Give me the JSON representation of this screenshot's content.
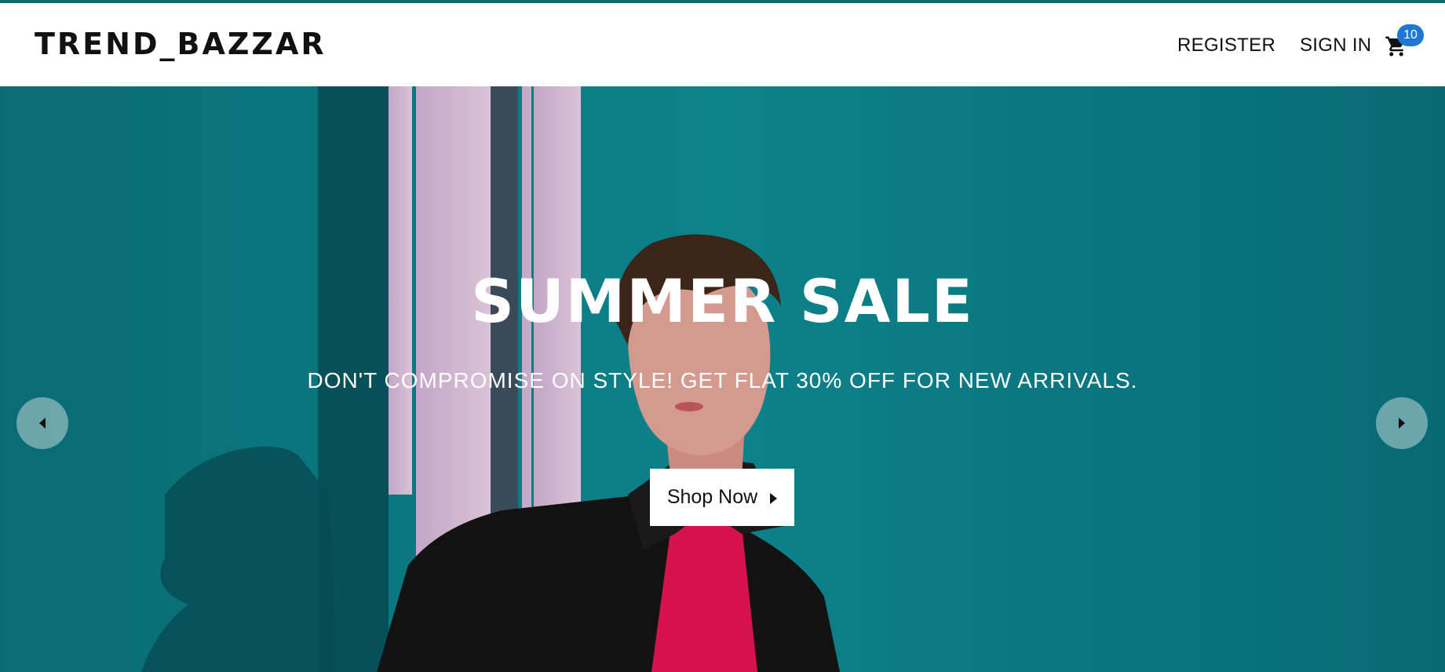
{
  "brand": {
    "logo_text": "TREND_BAZZAR"
  },
  "nav": {
    "register_label": "REGISTER",
    "signin_label": "SIGN IN",
    "cart_icon": "shopping-cart-icon",
    "cart_count": "10"
  },
  "hero": {
    "title": "SUMMER SALE",
    "subtitle": "DON'T COMPROMISE ON STYLE! GET FLAT 30% OFF FOR NEW ARRIVALS.",
    "cta_label": "Shop Now",
    "cta_icon": "caret-right-icon",
    "prev_icon": "caret-left-icon",
    "next_icon": "caret-right-icon"
  },
  "colors": {
    "top_strip": "#0d6b6b",
    "hero_background": "#0b7f88",
    "cart_badge": "#1e78d2",
    "jacket": "#111111",
    "shirt": "#d4124c"
  }
}
